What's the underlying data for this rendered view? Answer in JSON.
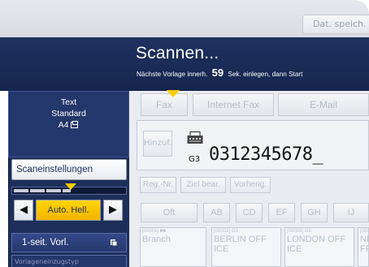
{
  "top": {
    "dat_button_label": "Dat. speich."
  },
  "header": {
    "title": "Scannen...",
    "msg_prefix": "Nächste Vorlage innerh.",
    "seconds": "59",
    "msg_suffix": "Sek. einlegen, dann Start"
  },
  "left": {
    "settings_lines": [
      "Text",
      "Standard",
      "A4"
    ],
    "scan_settings_label": "Scaneinstellungen",
    "density_label": "Auto. Hell.",
    "sided_label": "1-seit. Vorl.",
    "orig_settings_label": "Vorlageneinzugstyp"
  },
  "tabs": [
    "Fax",
    "Internet Fax",
    "E-Mail"
  ],
  "destination": {
    "add_label": "Hinzuf.",
    "line_type": "G3",
    "number": "0312345678_"
  },
  "dest_buttons": [
    "Reg.-Nr.",
    "Ziel bear.",
    "Vorherig."
  ],
  "alpha_tabs": [
    "Oft",
    "AB",
    "CD",
    "EF",
    "GH",
    "IJ"
  ],
  "entries": [
    {
      "code": "[00001] ■■",
      "name": "Branch"
    },
    {
      "code": "[00002] G3",
      "name": "BERLIN OFF",
      "sub": "ICE"
    },
    {
      "code": "[00003] G3",
      "name": "LONDON OFF",
      "sub": "ICE"
    },
    {
      "code": "[00004] G3",
      "name": "NE",
      "sub": "FF"
    }
  ],
  "colors": {
    "navy": "#1f3160",
    "accent_yellow": "#ffcc00",
    "disabled_text": "#b5bcc7"
  }
}
